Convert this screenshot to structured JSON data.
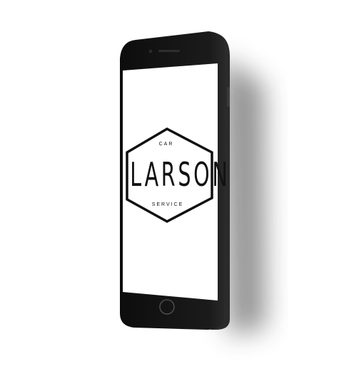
{
  "logo": {
    "top_text": "CAR",
    "main_text": "LARSON",
    "bottom_text": "SERVICE"
  },
  "colors": {
    "phone_body": "#151515",
    "screen": "#ffffff",
    "logo_ink": "#111111",
    "shadow": "#444444"
  },
  "icons": {
    "home_button": "home-button-icon",
    "camera": "front-camera-icon",
    "speaker": "earpiece-speaker-icon"
  }
}
